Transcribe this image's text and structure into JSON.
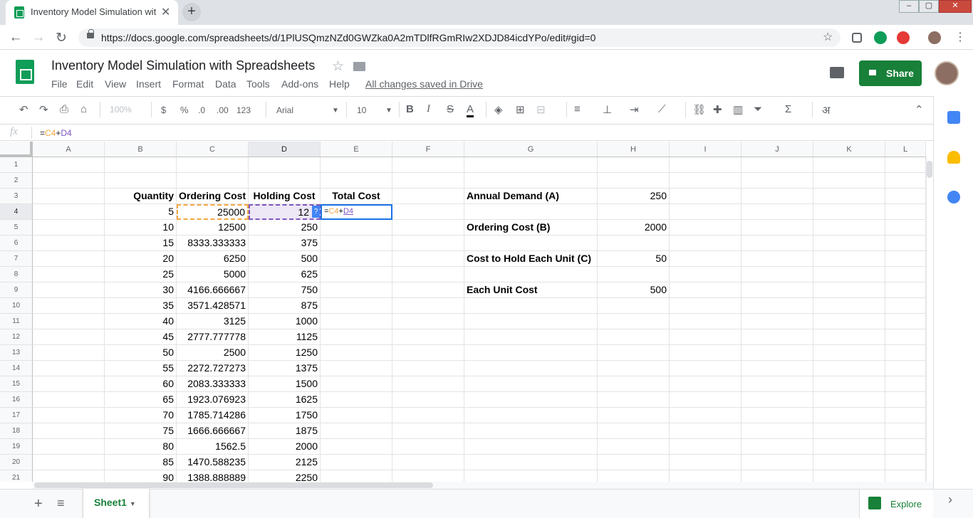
{
  "browser": {
    "tab_title": "Inventory Model Simulation with Spreadsheets",
    "url": "https://docs.google.com/spreadsheets/d/1PlUSQmzNZd0GWZka0A2mTDlfRGmRIw2XDJD84icdYPo/edit#gid=0",
    "new_tab_label": "+",
    "window_controls": [
      "–",
      "▢",
      "✕"
    ]
  },
  "doc": {
    "title": "Inventory Model Simulation with Spreadsheets",
    "menus": [
      "File",
      "Edit",
      "View",
      "Insert",
      "Format",
      "Data",
      "Tools",
      "Add-ons",
      "Help"
    ],
    "save_status": "All changes saved in Drive",
    "share_label": "Share"
  },
  "toolbar": {
    "zoom": "100%",
    "currency": "$",
    "percent": "%",
    "decimal_decrease": ".0",
    "decimal_increase": ".00",
    "more_formats": "123",
    "font": "Arial",
    "font_size": "10",
    "bold": "B",
    "italic": "I",
    "strike": "S",
    "text_color": "A",
    "input_tools": "अ"
  },
  "formula_bar": {
    "fx": "fx",
    "formula": "=C4+D4"
  },
  "columns": [
    "A",
    "B",
    "C",
    "D",
    "E",
    "F",
    "G",
    "H",
    "I",
    "J",
    "K",
    "L"
  ],
  "rows": [
    "1",
    "2",
    "3",
    "4",
    "5",
    "6",
    "7",
    "8",
    "9",
    "10",
    "11",
    "12",
    "13",
    "14",
    "15",
    "16",
    "17",
    "18",
    "19",
    "20",
    "21"
  ],
  "table": {
    "headers": {
      "quantity": "Quantity",
      "ordering_cost": "Ordering Cost",
      "holding_cost": "Holding Cost",
      "total_cost": "Total Cost"
    },
    "rows": [
      {
        "quantity": "5",
        "ordering_cost": "25000",
        "holding_cost": "12",
        "total_cost": "=C4+D4"
      },
      {
        "quantity": "10",
        "ordering_cost": "12500",
        "holding_cost": "250"
      },
      {
        "quantity": "15",
        "ordering_cost": "8333.333333",
        "holding_cost": "375"
      },
      {
        "quantity": "20",
        "ordering_cost": "6250",
        "holding_cost": "500"
      },
      {
        "quantity": "25",
        "ordering_cost": "5000",
        "holding_cost": "625"
      },
      {
        "quantity": "30",
        "ordering_cost": "4166.666667",
        "holding_cost": "750"
      },
      {
        "quantity": "35",
        "ordering_cost": "3571.428571",
        "holding_cost": "875"
      },
      {
        "quantity": "40",
        "ordering_cost": "3125",
        "holding_cost": "1000"
      },
      {
        "quantity": "45",
        "ordering_cost": "2777.777778",
        "holding_cost": "1125"
      },
      {
        "quantity": "50",
        "ordering_cost": "2500",
        "holding_cost": "1250"
      },
      {
        "quantity": "55",
        "ordering_cost": "2272.727273",
        "holding_cost": "1375"
      },
      {
        "quantity": "60",
        "ordering_cost": "2083.333333",
        "holding_cost": "1500"
      },
      {
        "quantity": "65",
        "ordering_cost": "1923.076923",
        "holding_cost": "1625"
      },
      {
        "quantity": "70",
        "ordering_cost": "1785.714286",
        "holding_cost": "1750"
      },
      {
        "quantity": "75",
        "ordering_cost": "1666.666667",
        "holding_cost": "1875"
      },
      {
        "quantity": "80",
        "ordering_cost": "1562.5",
        "holding_cost": "2000"
      },
      {
        "quantity": "85",
        "ordering_cost": "1470.588235",
        "holding_cost": "2125"
      },
      {
        "quantity": "90",
        "ordering_cost": "1388.888889",
        "holding_cost": "2250"
      }
    ]
  },
  "params": [
    {
      "label": "Annual Demand (A)",
      "value": "250"
    },
    {
      "label": "Ordering Cost (B)",
      "value": "2000"
    },
    {
      "label": "Cost to Hold Each Unit (C)",
      "value": "50"
    },
    {
      "label": "Each Unit Cost",
      "value": "500"
    }
  ],
  "sheet": {
    "name": "Sheet1",
    "explore_label": "Explore"
  },
  "colors": {
    "accent": "#188038",
    "selection": "#1a73e8",
    "ref_c": "#f4a742",
    "ref_d": "#7e57c2"
  }
}
